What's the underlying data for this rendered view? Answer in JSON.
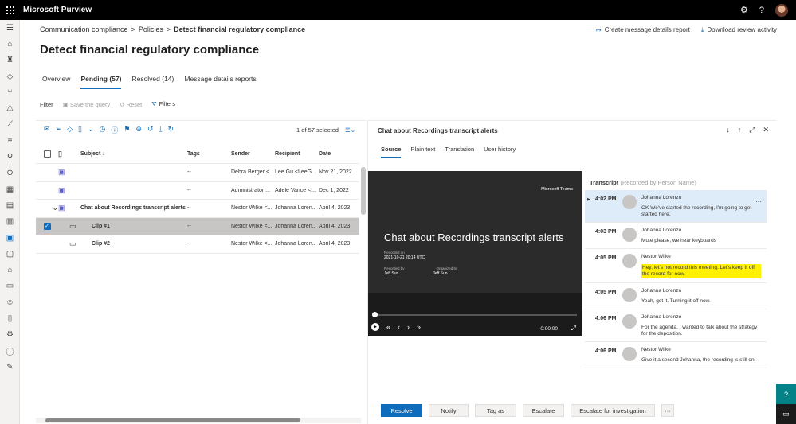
{
  "app": {
    "title": "Microsoft Purview"
  },
  "icons": {
    "waffle": "waffle-icon",
    "settings": "gear-icon",
    "help": "help-icon",
    "avatar": "user-avatar"
  },
  "leftnav": [
    "menu-icon",
    "home-icon",
    "trophy-icon",
    "tag-icon",
    "workflow-icon",
    "alert-icon",
    "chart-icon",
    "settings-sliders-icon",
    "search-icon",
    "medal-icon",
    "grid-icon",
    "document-icon",
    "report-icon",
    "communication-icon",
    "lock-icon",
    "bank-icon",
    "archive-icon",
    "user-search-icon",
    "folder-icon",
    "gear-icon",
    "info-icon",
    "edit-icon"
  ],
  "breadcrumb": {
    "item1": "Communication compliance",
    "item2": "Policies",
    "current": "Detect financial regulatory compliance",
    "sep": ">"
  },
  "top_actions": {
    "create_report": "Create message details report",
    "download": "Download review activity"
  },
  "page": {
    "title": "Detect financial regulatory compliance"
  },
  "tabs": {
    "overview": "Overview",
    "pending": "Pending (57)",
    "resolved": "Resolved (14)",
    "reports": "Message details reports"
  },
  "filter": {
    "label": "Filter",
    "save": "Save the query",
    "reset": "Reset",
    "filters": "Filters"
  },
  "list": {
    "selected": "1 of 57 selected",
    "columns": {
      "subject": "Subject ↓",
      "tags": "Tags",
      "sender": "Sender",
      "recipient": "Recipient",
      "date": "Date"
    },
    "rows": [
      {
        "subject": "",
        "tags": "--",
        "sender": "Debra Berger <...",
        "recipient": "Lee Gu <LeeG...",
        "date": "Nov 21, 2022"
      },
      {
        "subject": "",
        "tags": "--",
        "sender": "Administrator ...",
        "recipient": "Adele Vance <...",
        "date": "Dec 1, 2022"
      },
      {
        "subject": "Chat about Recordings transcript alerts",
        "tags": "--",
        "sender": "Nestor Wilke <...",
        "recipient": "Johanna Loren...",
        "date": "April 4, 2023"
      },
      {
        "subject": "Clip #1",
        "tags": "--",
        "sender": "Nestor Wilke <...",
        "recipient": "Johanna Loren...",
        "date": "April 4, 2023"
      },
      {
        "subject": "Clip #2",
        "tags": "--",
        "sender": "Nestor Wilke <...",
        "recipient": "Johanna Loren...",
        "date": "April 4, 2023"
      }
    ]
  },
  "detail": {
    "title": "Chat about Recordings transcript alerts",
    "tabs": {
      "source": "Source",
      "plain": "Plain text",
      "translation": "Translation",
      "history": "User history"
    }
  },
  "video": {
    "brand": "Microsoft Teams",
    "title": "Chat about Recordings transcript alerts",
    "recorded_label": "Recorded on",
    "recorded_on": "2021-10-21 20:14 UTC",
    "recorded_by_label": "Recorded by",
    "organized_by_label": "Organized by",
    "recorded_by": "Jeff Sun",
    "organized_by": "Jeff Sun",
    "time": "0:00:00",
    "progress": 0
  },
  "transcript": {
    "title": "Transcript",
    "subtitle": "(Recorded by Person Name)",
    "entries": [
      {
        "time": "4:02 PM",
        "name": "Johanna Lorenzo",
        "msg": "OK We've started the recording, I'm going to get started here."
      },
      {
        "time": "4:03 PM",
        "name": "Johanna Lorenzo",
        "msg": "Mute please, we hear keyboards"
      },
      {
        "time": "4:05 PM",
        "name": "Nestor Wilke",
        "msg": "Hey, let's not record this meeting. Let's keep it off the record for now."
      },
      {
        "time": "4:05 PM",
        "name": "Johanna Lorenzo",
        "msg": "Yeah, got it. Turning it off now."
      },
      {
        "time": "4:06 PM",
        "name": "Johanna Lorenzo",
        "msg": "For the agenda, I wanted to talk about the strategy for the deposition."
      },
      {
        "time": "4:06 PM",
        "name": "Nestor Wilke",
        "msg": "Give it a second Johanna, the recording is still on."
      }
    ]
  },
  "actions": {
    "resolve": "Resolve",
    "notify": "Notify",
    "tag": "Tag as",
    "escalate": "Escalate",
    "investigate": "Escalate for investigation",
    "more": "···"
  },
  "colors": {
    "accent": "#0f6cbd",
    "highlight": "#fff100",
    "topbar": "#000000"
  }
}
